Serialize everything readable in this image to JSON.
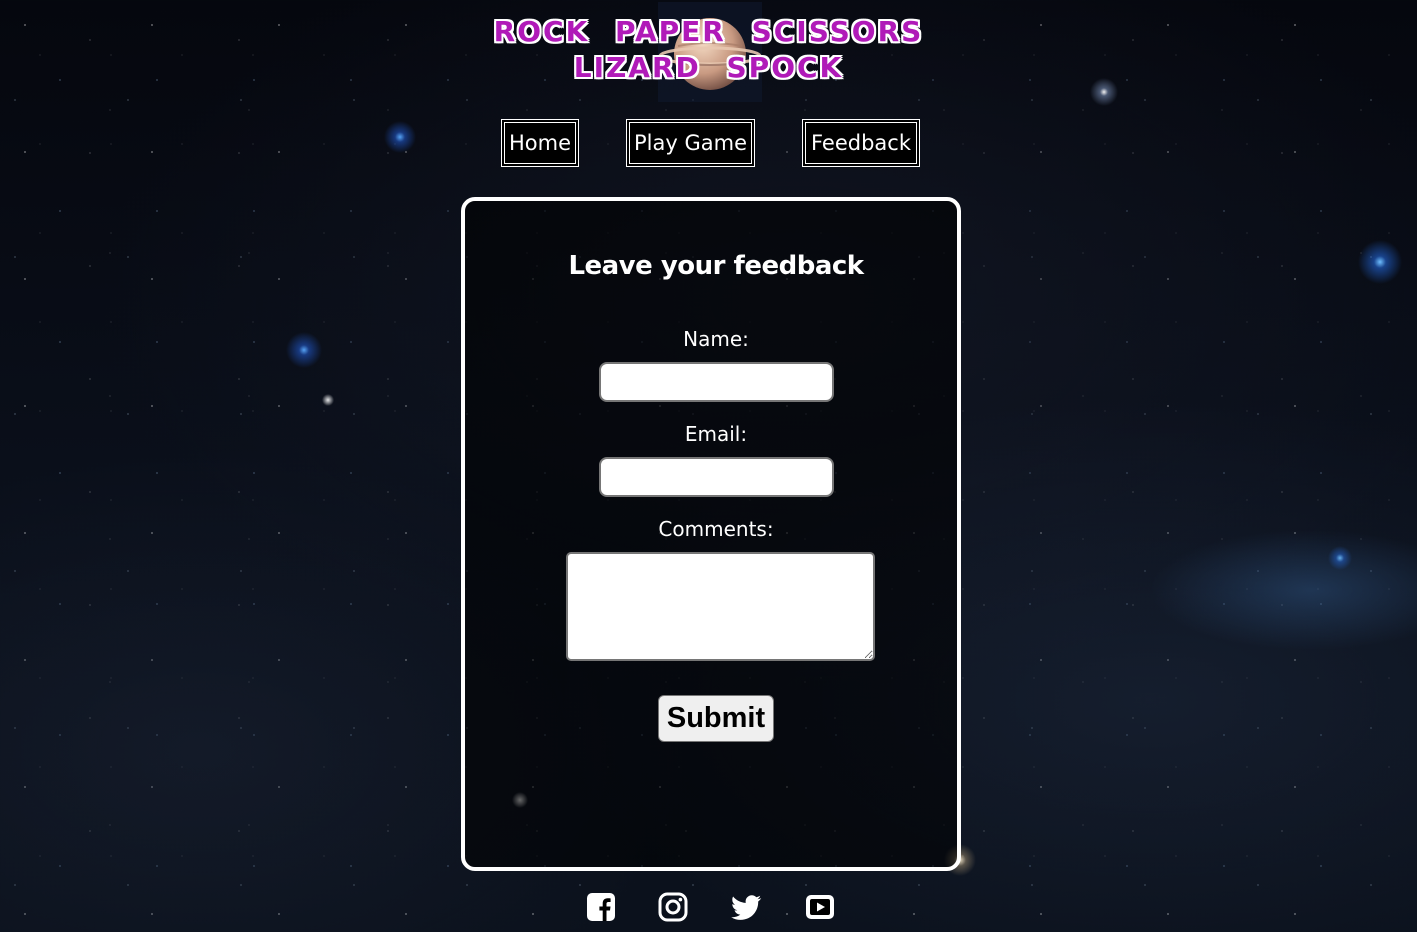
{
  "header": {
    "title_line1": "ROCK PAPER SCISSORS",
    "title_line2": "LIZARD SPOCK",
    "title_color": "#b01ab8"
  },
  "nav": {
    "items": [
      {
        "label": "Home"
      },
      {
        "label": "Play Game"
      },
      {
        "label": "Feedback"
      }
    ]
  },
  "feedback_form": {
    "title": "Leave your feedback",
    "name_label": "Name:",
    "name_value": "",
    "email_label": "Email:",
    "email_value": "",
    "comments_label": "Comments:",
    "comments_value": "",
    "submit_label": "Submit"
  },
  "footer": {
    "social_icons": [
      "facebook-icon",
      "instagram-icon",
      "twitter-icon",
      "youtube-icon"
    ]
  },
  "colors": {
    "background": "#03050b",
    "text": "#ffffff",
    "card_border": "#ffffff"
  }
}
